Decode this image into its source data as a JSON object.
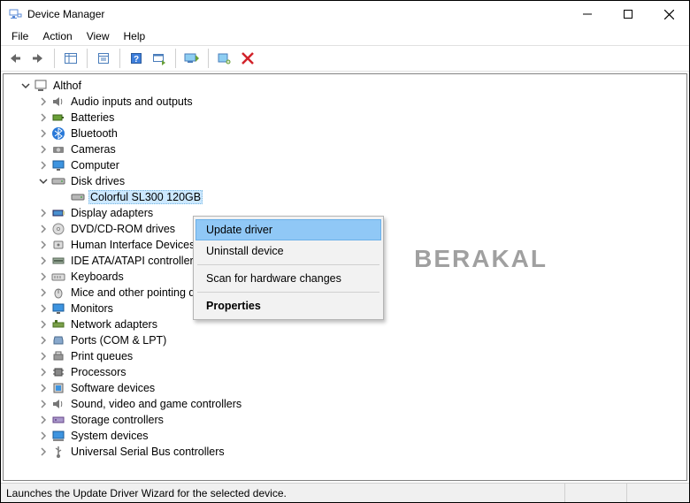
{
  "window": {
    "title": "Device Manager"
  },
  "menu": {
    "file": "File",
    "action": "Action",
    "view": "View",
    "help": "Help"
  },
  "tree": {
    "root": "Althof",
    "items": [
      {
        "label": "Audio inputs and outputs"
      },
      {
        "label": "Batteries"
      },
      {
        "label": "Bluetooth"
      },
      {
        "label": "Cameras"
      },
      {
        "label": "Computer"
      },
      {
        "label": "Disk drives",
        "expanded": true,
        "children": [
          {
            "label": "Colorful SL300 120GB",
            "selected": true
          }
        ]
      },
      {
        "label": "Display adapters"
      },
      {
        "label": "DVD/CD-ROM drives"
      },
      {
        "label": "Human Interface Devices"
      },
      {
        "label": "IDE ATA/ATAPI controllers"
      },
      {
        "label": "Keyboards"
      },
      {
        "label": "Mice and other pointing devices"
      },
      {
        "label": "Monitors"
      },
      {
        "label": "Network adapters"
      },
      {
        "label": "Ports (COM & LPT)"
      },
      {
        "label": "Print queues"
      },
      {
        "label": "Processors"
      },
      {
        "label": "Software devices"
      },
      {
        "label": "Sound, video and game controllers"
      },
      {
        "label": "Storage controllers"
      },
      {
        "label": "System devices"
      },
      {
        "label": "Universal Serial Bus controllers"
      }
    ]
  },
  "context_menu": {
    "update": "Update driver",
    "uninstall": "Uninstall device",
    "scan": "Scan for hardware changes",
    "properties": "Properties"
  },
  "status": {
    "text": "Launches the Update Driver Wizard for the selected device."
  },
  "watermark": "BERAKAL"
}
